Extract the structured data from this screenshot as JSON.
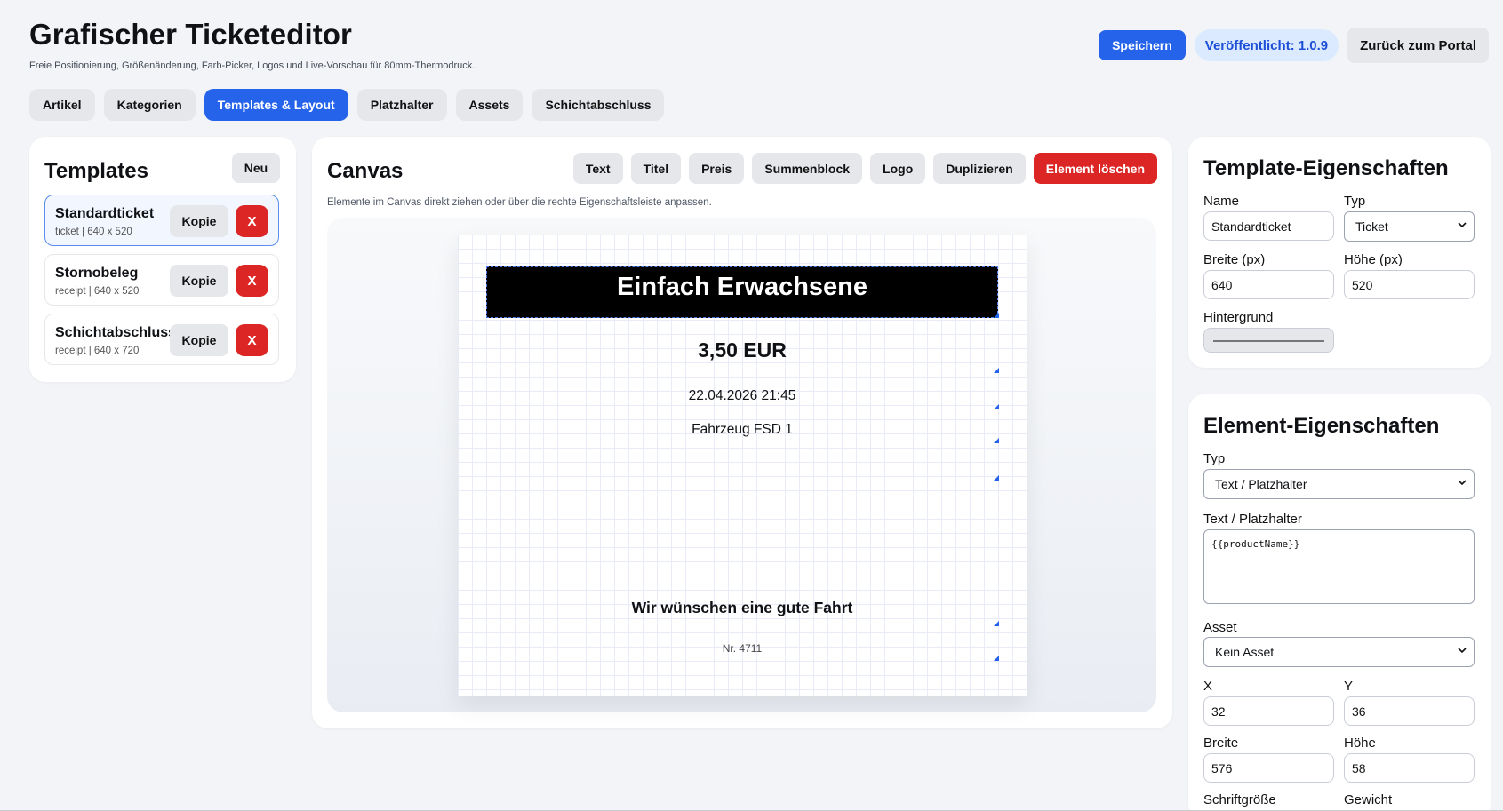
{
  "header": {
    "title": "Grafischer Ticketeditor",
    "subtitle": "Freie Positionierung, Größenänderung, Farb-Picker, Logos und Live-Vorschau für 80mm-Thermodruck.",
    "save_label": "Speichern",
    "version_label": "Veröffentlicht: 1.0.9",
    "back_label": "Zurück zum Portal"
  },
  "tabs": [
    {
      "label": "Artikel",
      "active": false
    },
    {
      "label": "Kategorien",
      "active": false
    },
    {
      "label": "Templates & Layout",
      "active": true
    },
    {
      "label": "Platzhalter",
      "active": false
    },
    {
      "label": "Assets",
      "active": false
    },
    {
      "label": "Schichtabschluss",
      "active": false
    }
  ],
  "templates": {
    "title": "Templates",
    "new_label": "Neu",
    "copy_label": "Kopie",
    "delete_label": "X",
    "items": [
      {
        "name": "Standardticket",
        "meta": "ticket | 640 x 520",
        "active": true
      },
      {
        "name": "Stornobeleg",
        "meta": "receipt | 640 x 520",
        "active": false
      },
      {
        "name": "Schichtabschluss",
        "meta": "receipt | 640 x 720",
        "active": false
      }
    ]
  },
  "canvas": {
    "title": "Canvas",
    "toolbar": [
      "Text",
      "Titel",
      "Preis",
      "Summenblock",
      "Logo",
      "Duplizieren"
    ],
    "delete_label": "Element löschen",
    "hint": "Elemente im Canvas direkt ziehen oder über die rechte Eigenschaftsleiste anpassen.",
    "ticket": {
      "title": "Einfach Erwachsene",
      "price": "3,50 EUR",
      "date": "22.04.2026 21:45",
      "vehicle": "Fahrzeug FSD 1",
      "wish": "Wir wünschen eine gute Fahrt",
      "number": "Nr. 4711"
    }
  },
  "template_props": {
    "title": "Template-Eigenschaften",
    "name_label": "Name",
    "name_value": "Standardticket",
    "type_label": "Typ",
    "type_value": "Ticket",
    "width_label": "Breite (px)",
    "width_value": "640",
    "height_label": "Höhe (px)",
    "height_value": "520",
    "background_label": "Hintergrund"
  },
  "element_props": {
    "title": "Element-Eigenschaften",
    "type_label": "Typ",
    "type_value": "Text / Platzhalter",
    "text_label": "Text / Platzhalter",
    "text_value": "{{productName}}",
    "asset_label": "Asset",
    "asset_value": "Kein Asset",
    "x_label": "X",
    "x_value": "32",
    "y_label": "Y",
    "y_value": "36",
    "width_label": "Breite",
    "width_value": "576",
    "height_label": "Höhe",
    "height_value": "58",
    "fontsize_label": "Schriftgröße",
    "weight_label": "Gewicht"
  }
}
